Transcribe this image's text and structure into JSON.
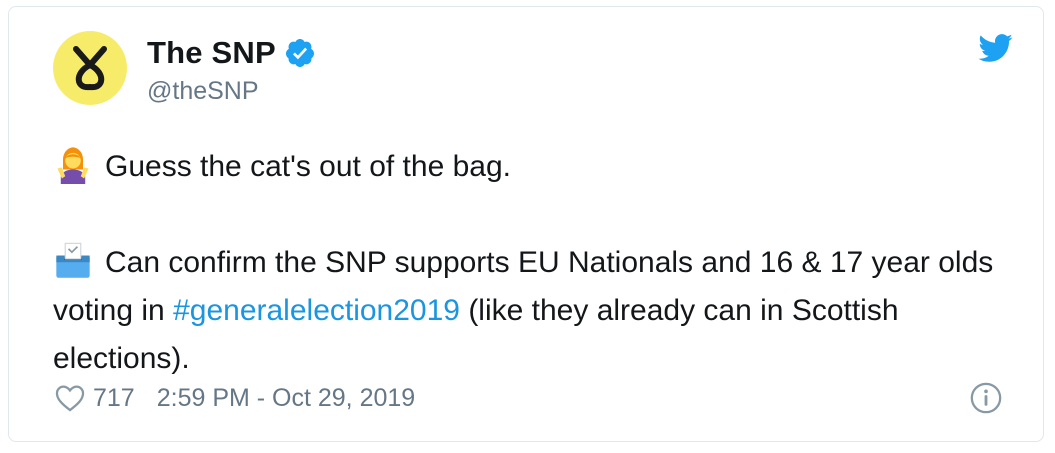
{
  "tweet": {
    "author_name": "The SNP",
    "handle": "@theSNP",
    "verified": true,
    "avatar_color": "#f7ec6a",
    "paragraph_1": {
      "emoji": "person-gesturing-ok-emoji",
      "text": "Guess the cat's out of the bag."
    },
    "paragraph_2": {
      "emoji": "ballot-box-emoji",
      "text_before": "Can confirm the SNP supports EU Nationals and 16 & 17 year olds voting in ",
      "hashtag": "#generalelection2019",
      "text_after": " (like they already can in Scottish elections)."
    },
    "like_count": "717",
    "timestamp": "2:59 PM - Oct 29, 2019"
  },
  "icons": {
    "bird": "twitter-bird-icon",
    "verified": "verified-badge-icon",
    "like": "heart-icon",
    "info": "info-icon"
  },
  "colors": {
    "link": "#1b95e0",
    "twitter_blue": "#1da1f2",
    "secondary_text": "#657786",
    "border": "#e1e8ed"
  }
}
